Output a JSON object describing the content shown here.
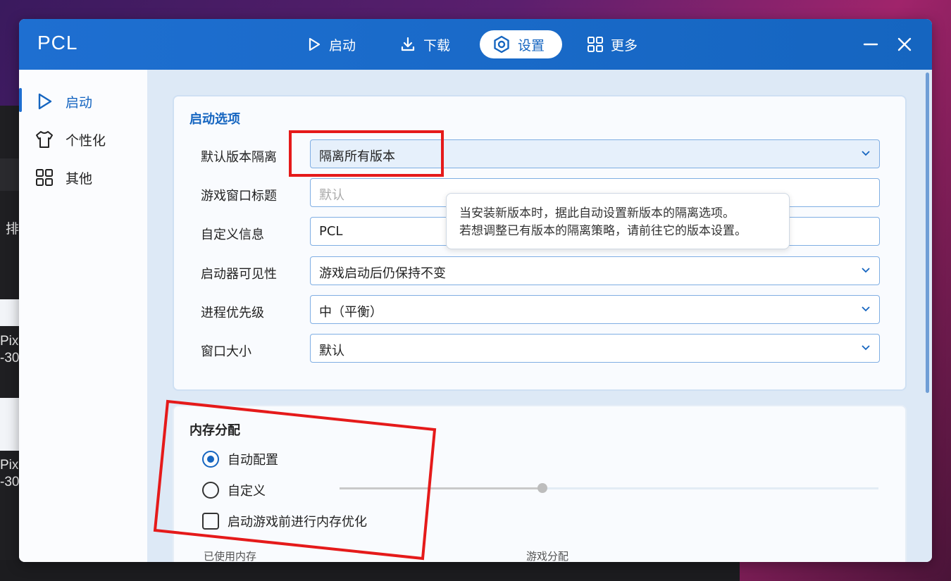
{
  "background": {
    "fragments": [
      "排",
      "Pixl",
      "-30",
      "Pixl",
      "-30"
    ]
  },
  "window": {
    "title": "PCL",
    "nav": [
      {
        "label": "启动",
        "icon": "play-icon"
      },
      {
        "label": "下载",
        "icon": "download-icon"
      },
      {
        "label": "设置",
        "icon": "settings-icon",
        "active": true
      },
      {
        "label": "更多",
        "icon": "grid-icon"
      }
    ]
  },
  "sidebar": {
    "items": [
      {
        "label": "启动",
        "icon": "play-icon",
        "active": true
      },
      {
        "label": "个性化",
        "icon": "shirt-icon"
      },
      {
        "label": "其他",
        "icon": "grid-icon"
      }
    ]
  },
  "launch_options": {
    "title": "启动选项",
    "rows": [
      {
        "label": "默认版本隔离",
        "value": "隔离所有版本",
        "type": "select"
      },
      {
        "label": "游戏窗口标题",
        "value": "",
        "placeholder": "默认",
        "type": "text"
      },
      {
        "label": "自定义信息",
        "value": "PCL",
        "type": "text"
      },
      {
        "label": "启动器可见性",
        "value": "游戏启动后仍保持不变",
        "type": "select"
      },
      {
        "label": "进程优先级",
        "value": "中（平衡）",
        "type": "select"
      },
      {
        "label": "窗口大小",
        "value": "默认",
        "type": "select"
      }
    ],
    "tooltip": {
      "line1": "当安装新版本时，据此自动设置新版本的隔离选项。",
      "line2": "若想调整已有版本的隔离策略，请前往它的版本设置。"
    }
  },
  "memory": {
    "title": "内存分配",
    "auto_label": "自动配置",
    "custom_label": "自定义",
    "optimize_label": "启动游戏前进行内存优化",
    "slider_fraction": 0.377,
    "used_label": "已使用内存",
    "game_label": "游戏分配"
  },
  "colors": {
    "accent": "#1565c0",
    "annotation": "#e51a1a"
  }
}
